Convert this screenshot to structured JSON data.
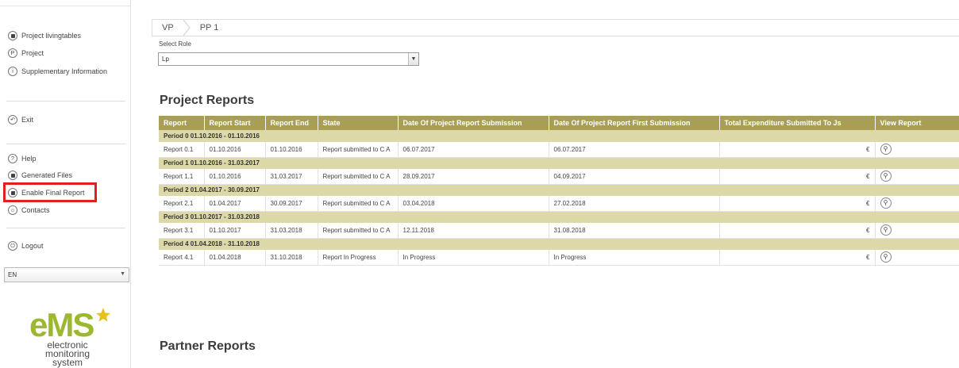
{
  "sidebar": {
    "items_top": [
      {
        "label": "Project livingtables",
        "icon": "table-icon"
      },
      {
        "label": "Project",
        "icon": "project-icon"
      },
      {
        "label": "Supplementary Information",
        "icon": "info-icon"
      }
    ],
    "exit": {
      "label": "Exit",
      "icon": "exit-icon"
    },
    "items_mid": [
      {
        "label": "Help",
        "icon": "help-icon"
      },
      {
        "label": "Generated Files",
        "icon": "files-icon"
      },
      {
        "label": "Enable Final Report",
        "icon": "report-icon"
      },
      {
        "label": "Contacts",
        "icon": "contacts-icon"
      }
    ],
    "logout": {
      "label": "Logout",
      "icon": "logout-icon"
    },
    "language": "EN",
    "logo": {
      "brand": "eMS",
      "line1": "electronic",
      "line2": "monitoring",
      "line3": "system"
    }
  },
  "breadcrumb": [
    "VP",
    "PP 1"
  ],
  "role": {
    "label": "Select Role",
    "value": "Lp"
  },
  "project_reports": {
    "title": "Project Reports",
    "columns": [
      "Report",
      "Report Start",
      "Report End",
      "State",
      "Date Of Project Report Submission",
      "Date Of Project Report First Submission",
      "Total Expenditure Submitted To Js",
      "View Report"
    ],
    "periods": [
      {
        "period": "Period 0 01.10.2016 - 01.10.2016",
        "row": {
          "report": "Report 0.1",
          "start": "01.10.2016",
          "end": "01.10.2016",
          "state": "Report submitted to C A",
          "submission": "06.07.2017",
          "first_submission": "06.07.2017",
          "total": "€"
        }
      },
      {
        "period": "Period 1 01.10.2016 - 31.03.2017",
        "row": {
          "report": "Report 1.1",
          "start": "01.10.2016",
          "end": "31.03.2017",
          "state": "Report submitted to C A",
          "submission": "28.09.2017",
          "first_submission": "04.09.2017",
          "total": "€"
        }
      },
      {
        "period": "Period 2 01.04.2017 - 30.09.2017",
        "row": {
          "report": "Report 2.1",
          "start": "01.04.2017",
          "end": "30.09.2017",
          "state": "Report submitted to C A",
          "submission": "03.04.2018",
          "first_submission": "27.02.2018",
          "total": "€"
        }
      },
      {
        "period": "Period 3 01.10.2017 - 31.03.2018",
        "row": {
          "report": "Report 3.1",
          "start": "01.10.2017",
          "end": "31.03.2018",
          "state": "Report submitted to C A",
          "submission": "12.11.2018",
          "first_submission": "31.08.2018",
          "total": "€"
        }
      },
      {
        "period": "Period 4 01.04.2018 - 31.10.2018",
        "row": {
          "report": "Report 4.1",
          "start": "01.04.2018",
          "end": "31.10.2018",
          "state": "Report In Progress",
          "submission": "In Progress",
          "first_submission": "In Progress",
          "total": "€"
        }
      }
    ]
  },
  "partner_reports": {
    "title": "Partner Reports"
  },
  "colors": {
    "header": "#a89f55",
    "period_row": "#ddd8a7",
    "highlight": "#e02020",
    "logo_green": "#9bb82e",
    "logo_star": "#e8c21c"
  }
}
